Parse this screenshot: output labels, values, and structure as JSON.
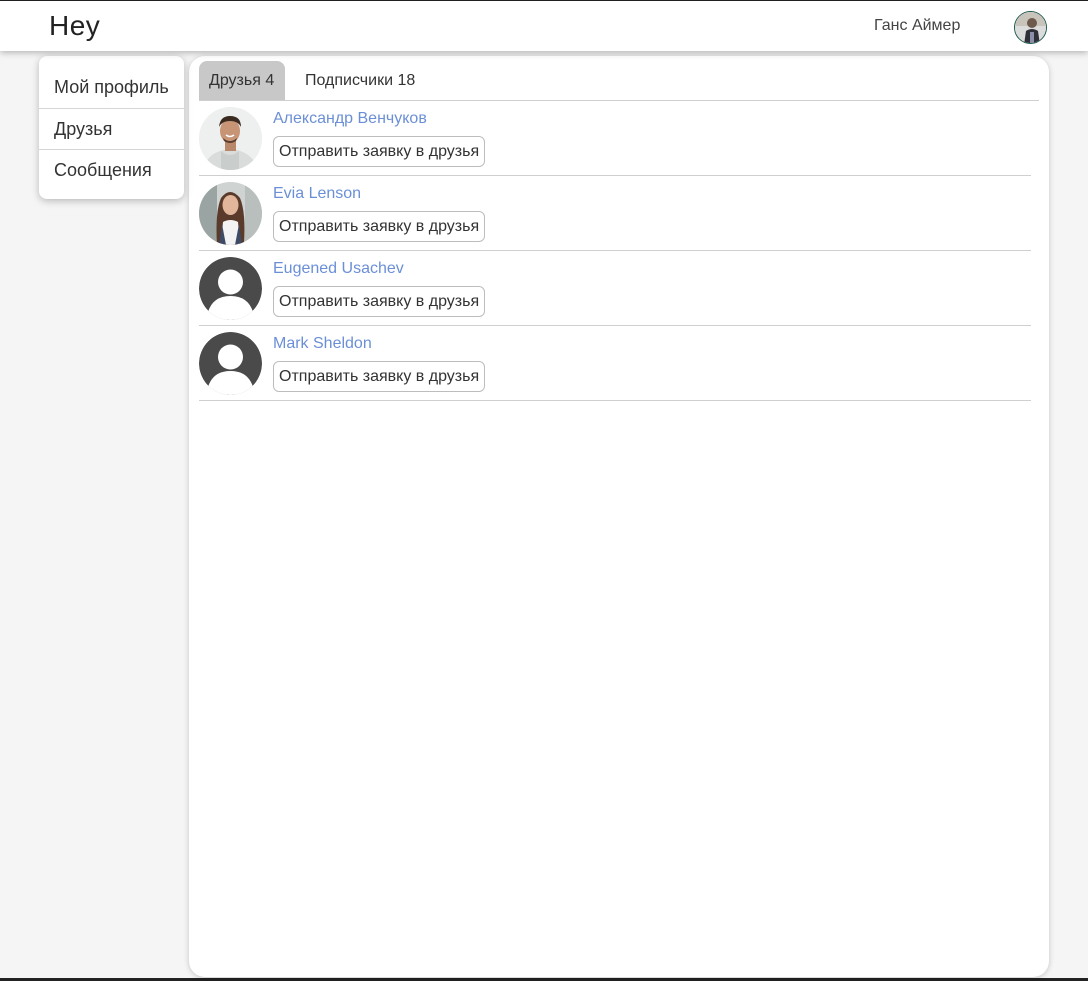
{
  "app": {
    "logo": "Hey"
  },
  "header": {
    "user_name": "Ганс Аймер"
  },
  "sidebar": {
    "items": [
      {
        "label": "Мой профиль"
      },
      {
        "label": "Друзья"
      },
      {
        "label": "Сообщения"
      }
    ]
  },
  "tabs": [
    {
      "label": "Друзья 4",
      "active": true
    },
    {
      "label": "Подписчики 18",
      "active": false
    }
  ],
  "friends": [
    {
      "name": "Александр Венчуков",
      "action": "Отправить заявку в друзья",
      "avatar": "man-photo"
    },
    {
      "name": "Evia Lenson",
      "action": "Отправить заявку в друзья",
      "avatar": "woman-photo"
    },
    {
      "name": "Eugened Usachev",
      "action": "Отправить заявку в друзья",
      "avatar": "default-user-icon"
    },
    {
      "name": "Mark Sheldon",
      "action": "Отправить заявку в друзья",
      "avatar": "default-user-icon"
    }
  ],
  "colors": {
    "link": "#6b8fd6",
    "active_tab": "#c8c8c8",
    "avatar_placeholder": "#4a4a4a"
  }
}
